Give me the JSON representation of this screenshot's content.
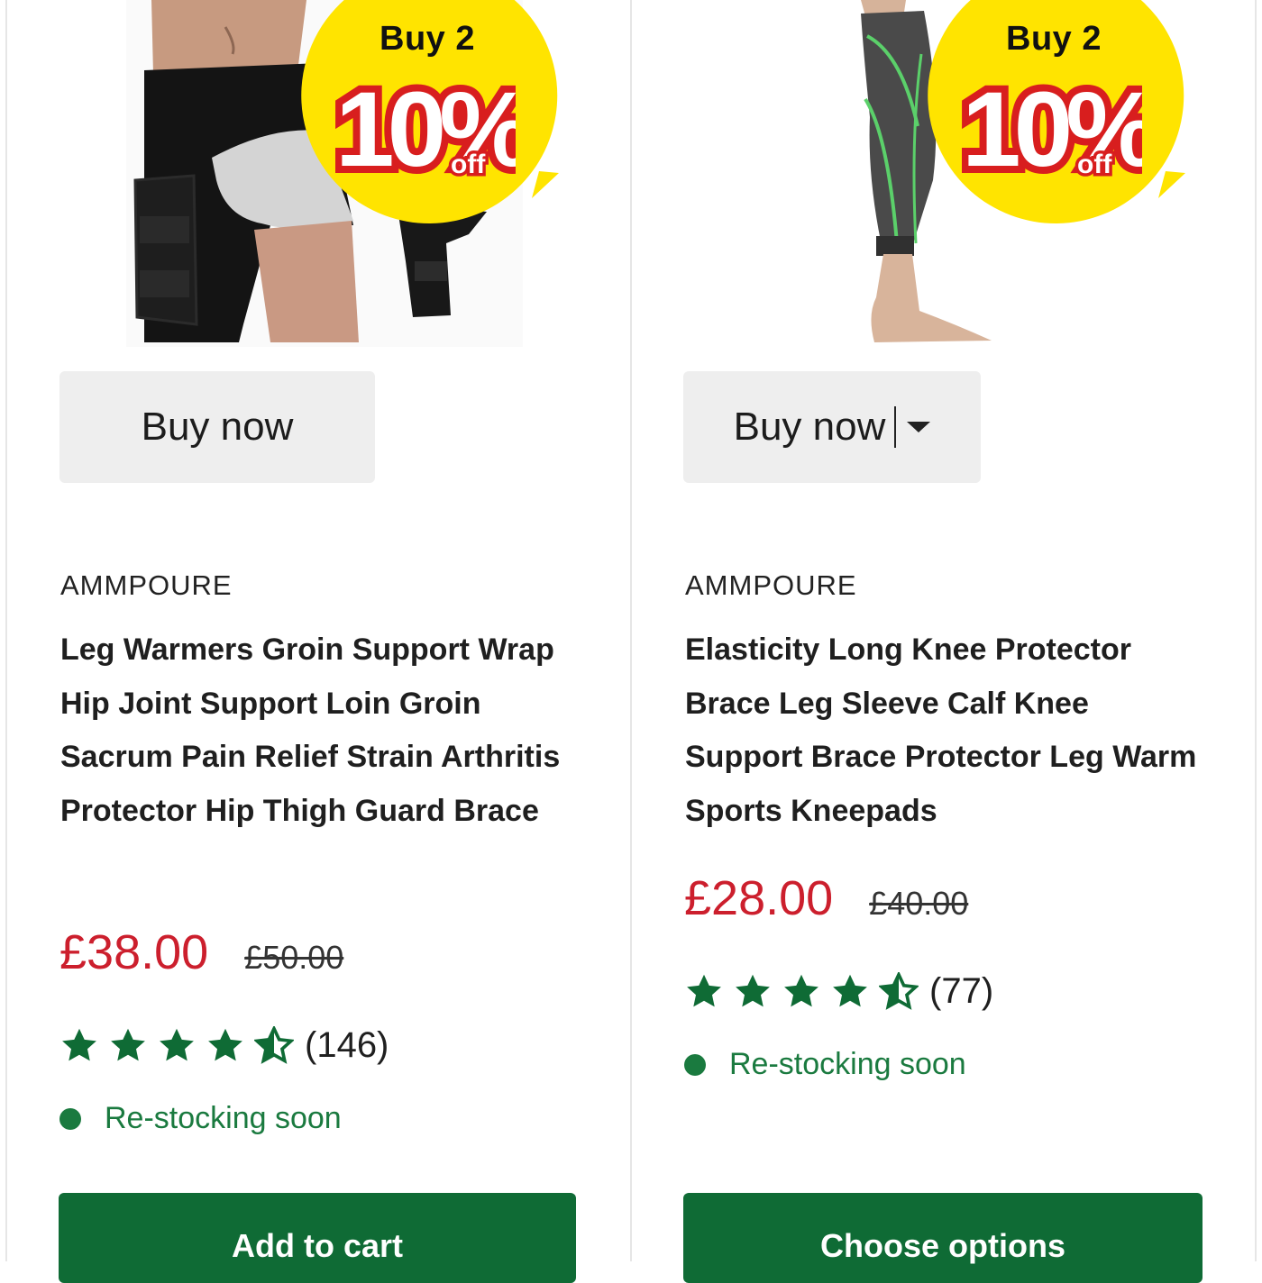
{
  "colors": {
    "price_now": "#cc1f2d",
    "stock_green": "#1a7a3f",
    "cta_green": "#0f6b35",
    "star_green": "#0f6b35",
    "badge_yellow": "#ffe400",
    "button_grey": "#eeeeee"
  },
  "products": [
    {
      "badge": {
        "line1": "Buy 2",
        "percent": "10%",
        "off": "off"
      },
      "buy_now_label": "Buy now",
      "has_dropdown": false,
      "brand": "AMMPOURE",
      "title": "Leg Warmers Groin Support Wrap Hip Joint Support Loin Groin Sacrum Pain Relief Strain Arthritis Protector Hip Thigh Guard Brace",
      "price_now": "£38.00",
      "price_was": "£50.00",
      "rating_value": 4.5,
      "rating_count": "(146)",
      "stock_status": "Re-stocking soon",
      "cta_label": "Add to cart",
      "image_icon": "hip-thigh-brace-photo"
    },
    {
      "badge": {
        "line1": "Buy 2",
        "percent": "10%",
        "off": "off"
      },
      "buy_now_label": "Buy now",
      "has_dropdown": true,
      "brand": "AMMPOURE",
      "title": "Elasticity Long Knee Protector Brace Leg Sleeve Calf Knee Support Brace Protector Leg Warm Sports Kneepads",
      "price_now": "£28.00",
      "price_was": "£40.00",
      "rating_value": 4.5,
      "rating_count": "(77)",
      "stock_status": "Re-stocking soon",
      "cta_label": "Choose options",
      "image_icon": "knee-sleeve-photo"
    }
  ]
}
